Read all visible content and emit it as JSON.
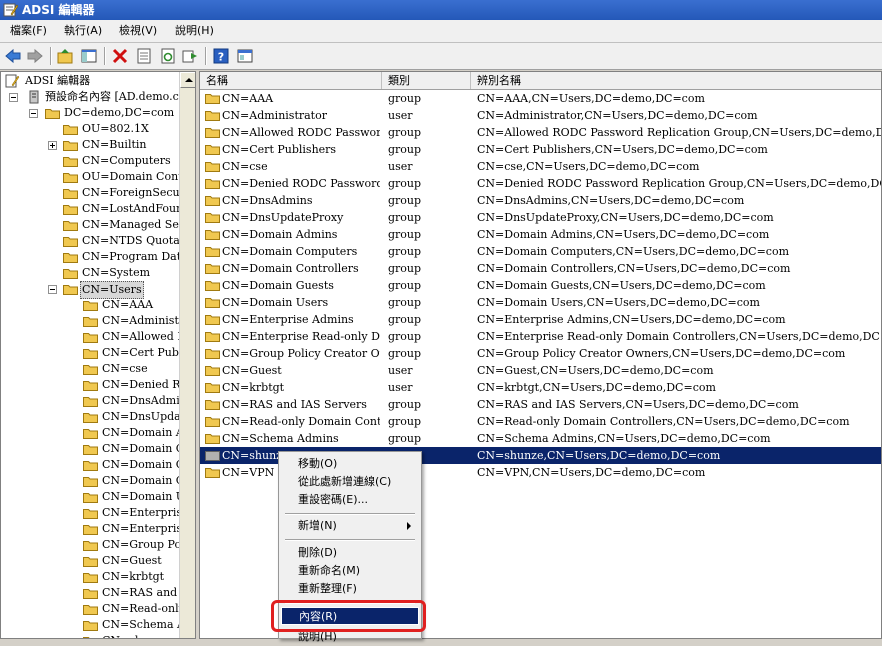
{
  "window": {
    "title": "ADSI 編輯器"
  },
  "menu": [
    "檔案(F)",
    "執行(A)",
    "檢視(V)",
    "說明(H)"
  ],
  "toolbar": [
    "back",
    "forward",
    "up-folder",
    "show-hide-tree",
    "delete",
    "properties",
    "refresh",
    "export",
    "help",
    "mmc"
  ],
  "tree": {
    "root": "ADSI 編輯器",
    "context": "預設命名內容 [AD.demo.co",
    "domain": "DC=demo,DC=com",
    "domain_children": [
      "OU=802.1X",
      "CN=Builtin",
      "CN=Computers",
      "OU=Domain Contro",
      "CN=ForeignSecurity",
      "CN=LostAndFound",
      "CN=Managed Servic",
      "CN=NTDS Quotas",
      "CN=Program Data",
      "CN=System",
      "CN=Users"
    ],
    "users_children": [
      "CN=AAA",
      "CN=Administrat",
      "CN=Allowed RO",
      "CN=Cert Publish",
      "CN=cse",
      "CN=Denied ROI",
      "CN=DnsAdmins",
      "CN=DnsUpdateI",
      "CN=Domain Ad",
      "CN=Domain Co",
      "CN=Domain Co",
      "CN=Domain Gu",
      "CN=Domain Us",
      "CN=Enterprise A",
      "CN=Enterprise F",
      "CN=Group Polic",
      "CN=Guest",
      "CN=krbtgt",
      "CN=RAS and IA",
      "CN=Read-only I",
      "CN=Schema Ad",
      "CN=shunze"
    ]
  },
  "list": {
    "columns": [
      "名稱",
      "類別",
      "辨別名稱"
    ],
    "rows": [
      {
        "name": "CN=AAA",
        "class": "group",
        "dn": "CN=AAA,CN=Users,DC=demo,DC=com"
      },
      {
        "name": "CN=Administrator",
        "class": "user",
        "dn": "CN=Administrator,CN=Users,DC=demo,DC=com"
      },
      {
        "name": "CN=Allowed RODC Password ...",
        "class": "group",
        "dn": "CN=Allowed RODC Password Replication Group,CN=Users,DC=demo,DC=com"
      },
      {
        "name": "CN=Cert Publishers",
        "class": "group",
        "dn": "CN=Cert Publishers,CN=Users,DC=demo,DC=com"
      },
      {
        "name": "CN=cse",
        "class": "user",
        "dn": "CN=cse,CN=Users,DC=demo,DC=com"
      },
      {
        "name": "CN=Denied RODC Password R...",
        "class": "group",
        "dn": "CN=Denied RODC Password Replication Group,CN=Users,DC=demo,DC=com"
      },
      {
        "name": "CN=DnsAdmins",
        "class": "group",
        "dn": "CN=DnsAdmins,CN=Users,DC=demo,DC=com"
      },
      {
        "name": "CN=DnsUpdateProxy",
        "class": "group",
        "dn": "CN=DnsUpdateProxy,CN=Users,DC=demo,DC=com"
      },
      {
        "name": "CN=Domain Admins",
        "class": "group",
        "dn": "CN=Domain Admins,CN=Users,DC=demo,DC=com"
      },
      {
        "name": "CN=Domain Computers",
        "class": "group",
        "dn": "CN=Domain Computers,CN=Users,DC=demo,DC=com"
      },
      {
        "name": "CN=Domain Controllers",
        "class": "group",
        "dn": "CN=Domain Controllers,CN=Users,DC=demo,DC=com"
      },
      {
        "name": "CN=Domain Guests",
        "class": "group",
        "dn": "CN=Domain Guests,CN=Users,DC=demo,DC=com"
      },
      {
        "name": "CN=Domain Users",
        "class": "group",
        "dn": "CN=Domain Users,CN=Users,DC=demo,DC=com"
      },
      {
        "name": "CN=Enterprise Admins",
        "class": "group",
        "dn": "CN=Enterprise Admins,CN=Users,DC=demo,DC=com"
      },
      {
        "name": "CN=Enterprise Read-only Dom...",
        "class": "group",
        "dn": "CN=Enterprise Read-only Domain Controllers,CN=Users,DC=demo,DC=com"
      },
      {
        "name": "CN=Group Policy Creator Own...",
        "class": "group",
        "dn": "CN=Group Policy Creator Owners,CN=Users,DC=demo,DC=com"
      },
      {
        "name": "CN=Guest",
        "class": "user",
        "dn": "CN=Guest,CN=Users,DC=demo,DC=com"
      },
      {
        "name": "CN=krbtgt",
        "class": "user",
        "dn": "CN=krbtgt,CN=Users,DC=demo,DC=com"
      },
      {
        "name": "CN=RAS and IAS Servers",
        "class": "group",
        "dn": "CN=RAS and IAS Servers,CN=Users,DC=demo,DC=com"
      },
      {
        "name": "CN=Read-only Domain Contro...",
        "class": "group",
        "dn": "CN=Read-only Domain Controllers,CN=Users,DC=demo,DC=com"
      },
      {
        "name": "CN=Schema Admins",
        "class": "group",
        "dn": "CN=Schema Admins,CN=Users,DC=demo,DC=com"
      },
      {
        "name": "CN=shunze",
        "class": "",
        "dn": "CN=shunze,CN=Users,DC=demo,DC=com",
        "selected": true
      },
      {
        "name": "CN=VPN",
        "class": "",
        "dn": "CN=VPN,CN=Users,DC=demo,DC=com"
      }
    ]
  },
  "context_menu": {
    "items": [
      "移動(O)",
      "從此處新增連線(C)",
      "重設密碼(E)...",
      "新增(N)",
      "刪除(D)",
      "重新命名(M)",
      "重新整理(F)",
      "內容(R)",
      "說明(H)"
    ],
    "highlighted": "內容(R)"
  },
  "colors": {
    "selection": "#0a246a",
    "highlight_ring": "#e02020",
    "folder": "#f0c850"
  }
}
